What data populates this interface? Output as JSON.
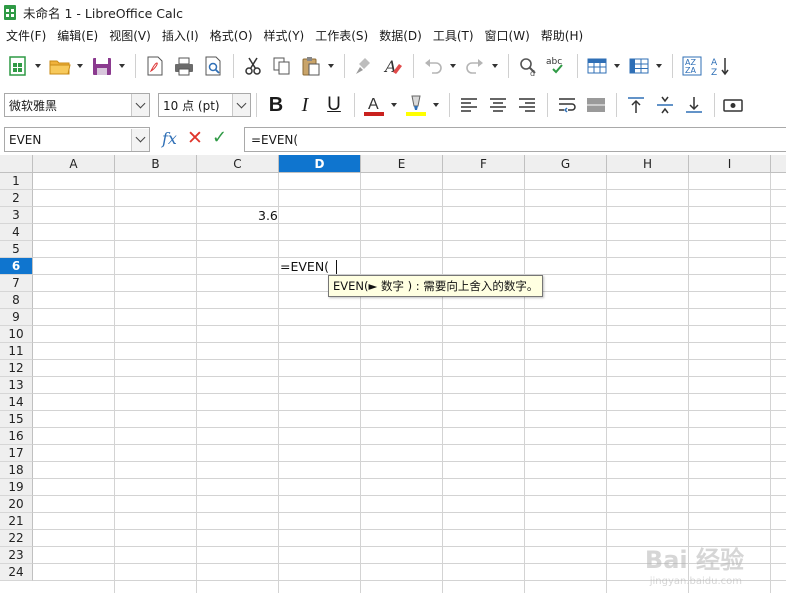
{
  "window": {
    "title": "未命名 1 - LibreOffice Calc"
  },
  "menu": [
    "文件(F)",
    "编辑(E)",
    "视图(V)",
    "插入(I)",
    "格式(O)",
    "样式(Y)",
    "工作表(S)",
    "数据(D)",
    "工具(T)",
    "窗口(W)",
    "帮助(H)"
  ],
  "toolbar2": {
    "font_name": "微软雅黑",
    "font_size": "10 点 (pt)"
  },
  "formula_bar": {
    "name_box": "EVEN",
    "fx": "fx",
    "cancel": "✕",
    "accept": "✓",
    "content": "=EVEN("
  },
  "sheet": {
    "columns": [
      "A",
      "B",
      "C",
      "D",
      "E",
      "F",
      "G",
      "H",
      "I"
    ],
    "active_column": "D",
    "rows": [
      "1",
      "2",
      "3",
      "4",
      "5",
      "6",
      "7",
      "8",
      "9",
      "10",
      "11",
      "12",
      "13",
      "14",
      "15",
      "16",
      "17",
      "18",
      "19",
      "20",
      "21",
      "22",
      "23",
      "24"
    ],
    "active_row": "6",
    "cells": {
      "C3": "3.6",
      "D6": "=EVEN("
    },
    "tooltip": "EVEN(► 数字 ) : 需要向上舍入的数字。"
  },
  "watermark": {
    "text": "Bai 经验",
    "sub": "jingyan.baidu.com"
  },
  "colors": {
    "accent": "#0f75cf",
    "font_color": "#c9211e",
    "highlight": "#ffff00"
  }
}
